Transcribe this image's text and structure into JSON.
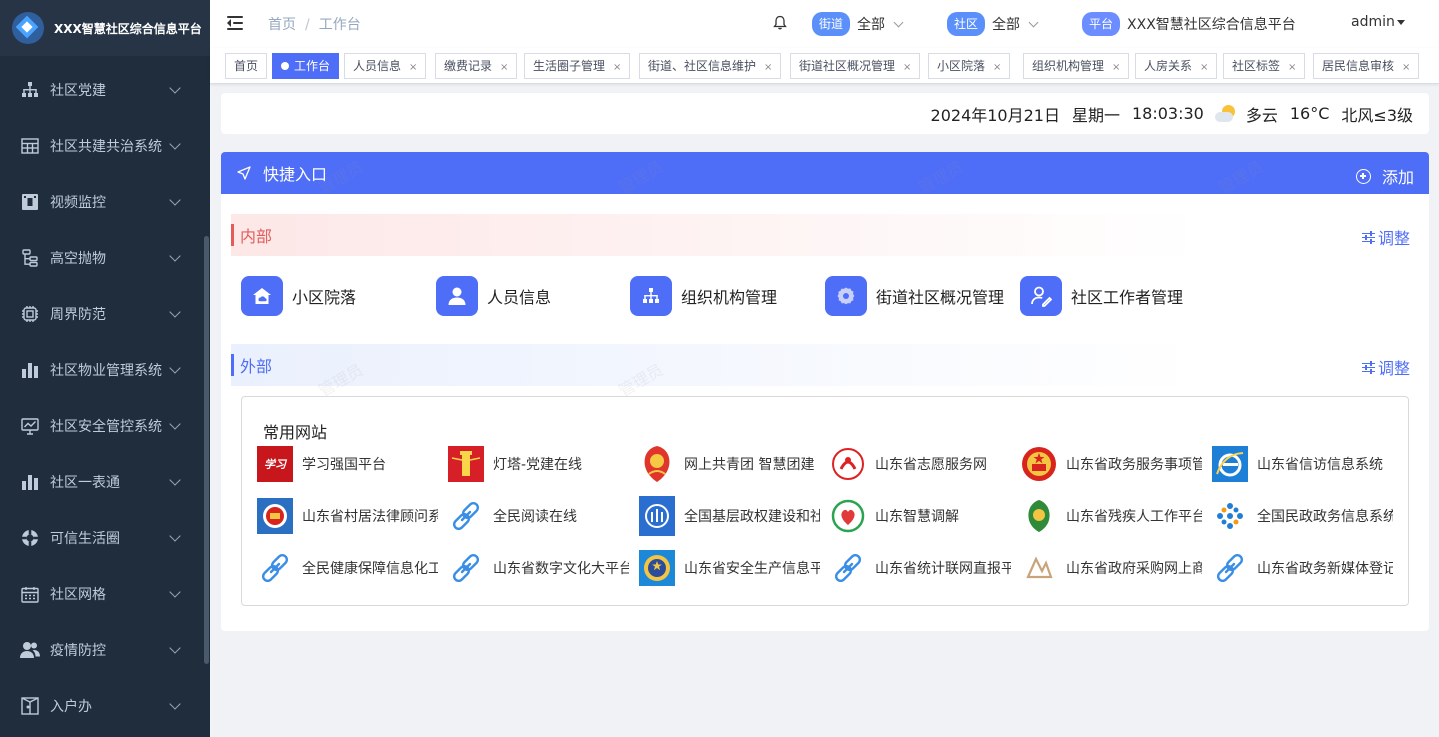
{
  "app": {
    "title": "XXX智慧社区综合信息平台"
  },
  "sidebar": {
    "items": [
      {
        "label": "社区党建",
        "icon": "org-chart-icon"
      },
      {
        "label": "社区共建共治系统",
        "icon": "table-grid-icon"
      },
      {
        "label": "视频监控",
        "icon": "film-icon"
      },
      {
        "label": "高空抛物",
        "icon": "tree-structure-icon"
      },
      {
        "label": "周界防范",
        "icon": "chip-icon"
      },
      {
        "label": "社区物业管理系统",
        "icon": "bar-chart-icon"
      },
      {
        "label": "社区安全管控系统",
        "icon": "monitor-chart-icon"
      },
      {
        "label": "社区一表通",
        "icon": "bar-chart-icon"
      },
      {
        "label": "可信生活圈",
        "icon": "lifebuoy-icon"
      },
      {
        "label": "社区网格",
        "icon": "calendar-grid-icon"
      },
      {
        "label": "疫情防控",
        "icon": "users-icon"
      },
      {
        "label": "入户办",
        "icon": "door-icon"
      }
    ]
  },
  "header": {
    "breadcrumb": [
      "首页",
      "工作台"
    ],
    "street": {
      "tag": "街道",
      "value": "全部"
    },
    "community": {
      "tag": "社区",
      "value": "全部"
    },
    "platform": {
      "tag": "平台",
      "value": "XXX智慧社区综合信息平台"
    },
    "user": "admin"
  },
  "tabs": [
    {
      "label": "首页",
      "closable": false,
      "active": false
    },
    {
      "label": "工作台",
      "closable": false,
      "active": true
    },
    {
      "label": "人员信息",
      "closable": true,
      "active": false
    },
    {
      "label": "缴费记录",
      "closable": true,
      "active": false
    },
    {
      "label": "生活圈子管理",
      "closable": true,
      "active": false
    },
    {
      "label": "街道、社区信息维护",
      "closable": true,
      "active": false
    },
    {
      "label": "街道社区概况管理",
      "closable": true,
      "active": false
    },
    {
      "label": "小区院落",
      "closable": true,
      "active": false
    },
    {
      "label": "组织机构管理",
      "closable": true,
      "active": false
    },
    {
      "label": "人房关系",
      "closable": true,
      "active": false
    },
    {
      "label": "社区标签",
      "closable": true,
      "active": false
    },
    {
      "label": "居民信息审核",
      "closable": true,
      "active": false
    }
  ],
  "tab_close_glyph": "×",
  "datebar": {
    "date": "2024年10月21日",
    "weekday": "星期一",
    "time": "18:03:30",
    "weather": "多云",
    "weather_icon": "partly-cloudy-icon",
    "temp": "16°C",
    "wind": "北风≤3级"
  },
  "panel": {
    "title": "快捷入口",
    "add_label": "添加",
    "internal": {
      "label": "内部",
      "adjust": "调整",
      "items": [
        {
          "label": "小区院落",
          "icon": "house-cloud-icon"
        },
        {
          "label": "人员信息",
          "icon": "user-icon"
        },
        {
          "label": "组织机构管理",
          "icon": "org-chart-icon"
        },
        {
          "label": "街道社区概况管理",
          "icon": "gear-icon"
        },
        {
          "label": "社区工作者管理",
          "icon": "user-edit-icon"
        }
      ]
    },
    "external": {
      "label": "外部",
      "adjust": "调整",
      "sites_title": "常用网站",
      "sites": [
        {
          "name": "学习强国平台",
          "icon": "xuexi-logo"
        },
        {
          "name": "灯塔-党建在线",
          "icon": "lighthouse-logo"
        },
        {
          "name": "网上共青团 智慧团建",
          "icon": "youth-league-logo"
        },
        {
          "name": "山东省志愿服务网",
          "icon": "volunteer-logo"
        },
        {
          "name": "山东省政务服务事项管理",
          "icon": "national-emblem-logo"
        },
        {
          "name": "山东省信访信息系统",
          "icon": "ie-browser-logo"
        },
        {
          "name": "山东省村居法律顾问系统",
          "icon": "justice-logo"
        },
        {
          "name": "全民阅读在线",
          "icon": "link-icon"
        },
        {
          "name": "全国基层政权建设和社区治理",
          "icon": "civil-affairs-logo"
        },
        {
          "name": "山东智慧调解",
          "icon": "mediation-logo"
        },
        {
          "name": "山东省残疾人工作平台",
          "icon": "disabled-federation-logo"
        },
        {
          "name": "全国民政政务信息系统",
          "icon": "civil-dots-logo"
        },
        {
          "name": "全民健康保障信息化工程",
          "icon": "link-icon"
        },
        {
          "name": "山东省数字文化大平台",
          "icon": "link-icon"
        },
        {
          "name": "山东省安全生产信息平台",
          "icon": "safety-emblem-logo"
        },
        {
          "name": "山东省统计联网直报平台",
          "icon": "link-icon"
        },
        {
          "name": "山东省政府采购网上商城",
          "icon": "procurement-logo"
        },
        {
          "name": "山东省政务新媒体登记",
          "icon": "link-icon"
        }
      ]
    }
  },
  "watermark": "管理员",
  "colors": {
    "sidebar_bg": "#1f2d3d",
    "accent": "#4f6ef7",
    "internal_red": "#e25c5c",
    "tag_blue": "#5b8ff9"
  }
}
